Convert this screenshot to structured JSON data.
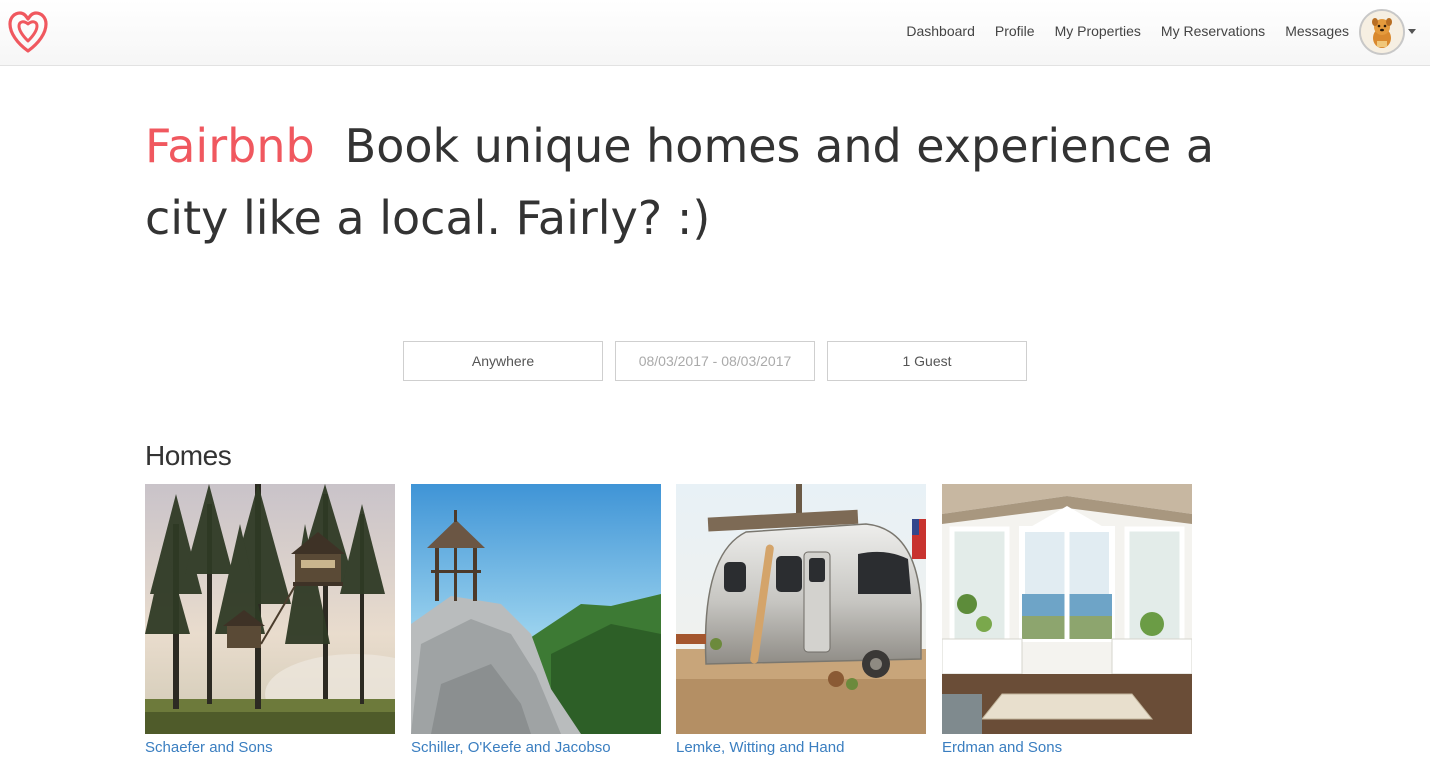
{
  "navbar": {
    "logo_icon": "airbnb-logo-icon",
    "links": [
      "Dashboard",
      "Profile",
      "My Properties",
      "My Reservations",
      "Messages"
    ],
    "avatar_icon": "user-avatar-icon",
    "dropdown_icon": "caret-down-icon"
  },
  "hero": {
    "brand": "Fairbnb",
    "tagline": "Book unique homes and experience a city like a local. Fairly? :)"
  },
  "search": {
    "location": "Anywhere",
    "dates": "08/03/2017 - 08/03/2017",
    "guests": "1 Guest"
  },
  "homes": {
    "title": "Homes",
    "items": [
      {
        "name": "Schaefer and Sons",
        "image": "treehouse-forest-photo"
      },
      {
        "name": "Schiller, O'Keefe and Jacobso",
        "image": "gazebo-mountain-photo"
      },
      {
        "name": "Lemke, Witting and Hand",
        "image": "airstream-trailer-photo"
      },
      {
        "name": "Erdman and Sons",
        "image": "sunroom-interior-photo"
      }
    ]
  },
  "colors": {
    "brand": "#f0585f",
    "link": "#3a7ec0"
  }
}
